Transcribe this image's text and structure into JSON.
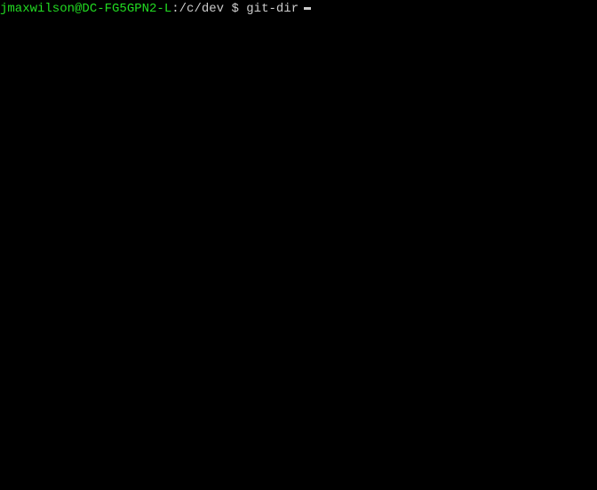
{
  "prompt": {
    "user_host": "jmaxwilson@DC-FG5GPN2-L",
    "colon": ":",
    "path": "/c/dev",
    "dollar": " $ ",
    "command": "git-dir"
  }
}
